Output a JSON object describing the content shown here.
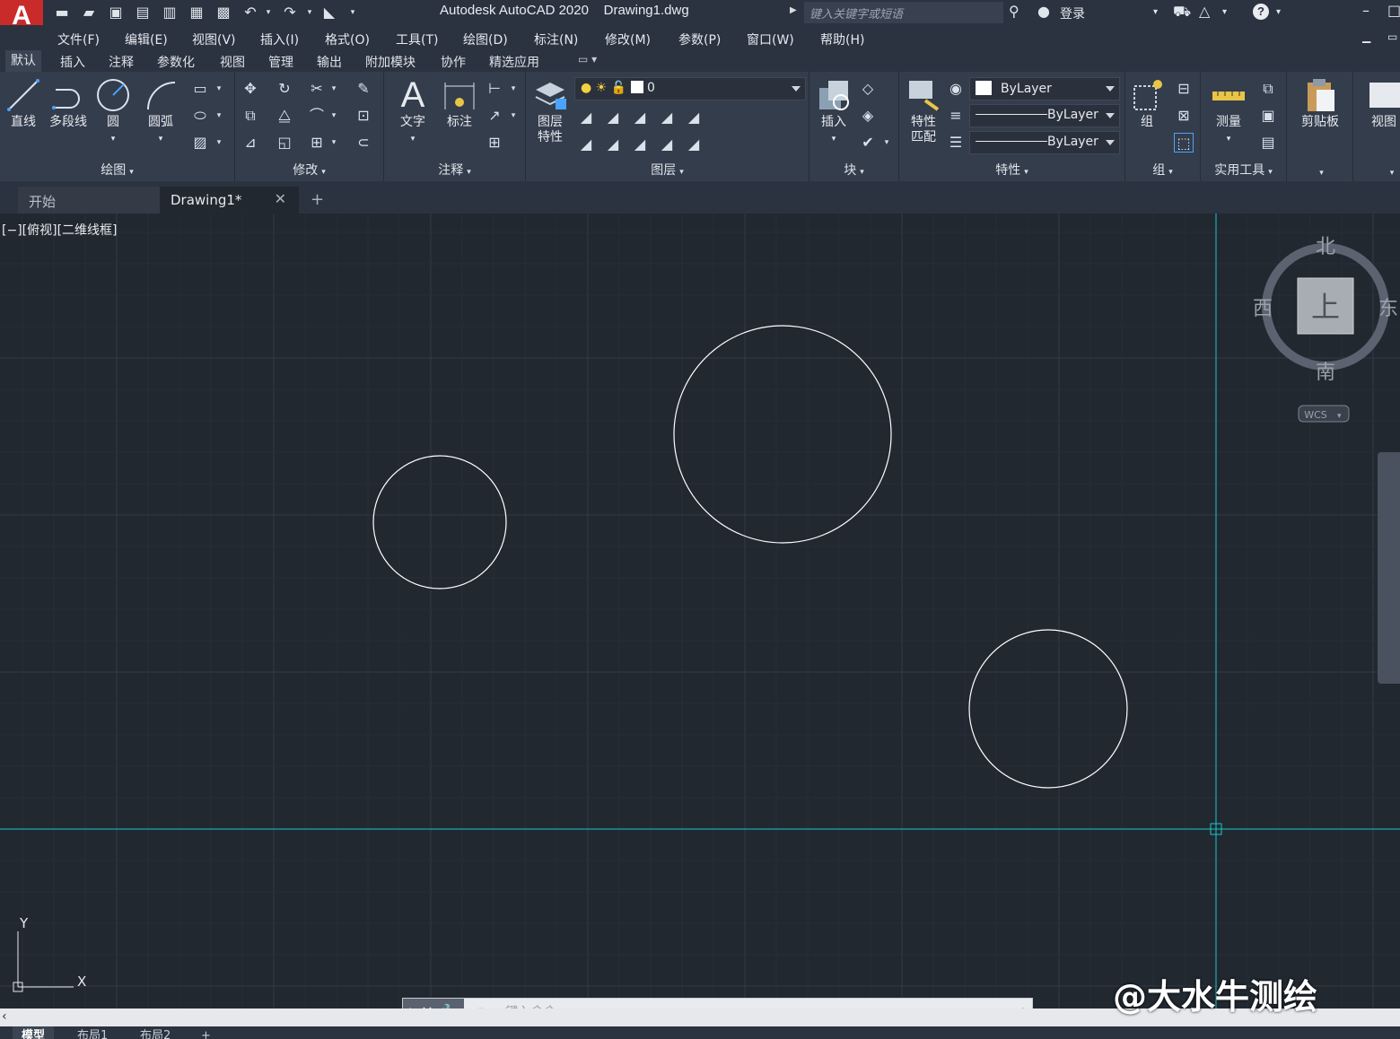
{
  "title_bar": {
    "app_letter": "A",
    "title": "Autodesk AutoCAD 2020    Drawing1.dwg",
    "search_placeholder": "键入关键字或短语",
    "login": "登录"
  },
  "menu": [
    "文件(F)",
    "编辑(E)",
    "视图(V)",
    "插入(I)",
    "格式(O)",
    "工具(T)",
    "绘图(D)",
    "标注(N)",
    "修改(M)",
    "参数(P)",
    "窗口(W)",
    "帮助(H)"
  ],
  "ribbon_tabs": [
    "默认",
    "插入",
    "注释",
    "参数化",
    "视图",
    "管理",
    "输出",
    "附加模块",
    "协作",
    "精选应用"
  ],
  "ribbon": {
    "draw": {
      "title": "绘图",
      "line": "直线",
      "polyline": "多段线",
      "circle": "圆",
      "arc": "圆弧"
    },
    "modify": {
      "title": "修改"
    },
    "annotation": {
      "title": "注释",
      "text": "文字",
      "dimension": "标注"
    },
    "layers": {
      "title": "图层",
      "props_line1": "图层",
      "props_line2": "特性",
      "current_layer": "0"
    },
    "block": {
      "title": "块",
      "insert": "插入"
    },
    "properties": {
      "title": "特性",
      "match_line1": "特性",
      "match_line2": "匹配",
      "color": "ByLayer",
      "linetype": "ByLayer",
      "lineweight": "ByLayer"
    },
    "groups": {
      "title": "组",
      "group": "组"
    },
    "utilities": {
      "title": "实用工具",
      "measure": "测量"
    },
    "clipboard": {
      "title": "剪贴板"
    },
    "view": {
      "title": "视图"
    }
  },
  "file_tabs": {
    "start": "开始",
    "drawing": "Drawing1*"
  },
  "viewport": {
    "view_label": "[−][俯视][二维线框]",
    "viewcube": {
      "north": "北",
      "south": "南",
      "east": "东",
      "west": "西",
      "top": "上",
      "wcs": "WCS"
    },
    "ucs": {
      "x": "X",
      "y": "Y"
    },
    "watermark": "@大水牛测绘"
  },
  "command_line": {
    "placeholder": "键入命令"
  },
  "status_tabs": [
    "模型",
    "布局1",
    "布局2"
  ],
  "colors": {
    "background": "#212830",
    "crosshair": "#19c8c8",
    "circle": "#ffffff",
    "logo": "#c92b2b"
  },
  "icons": [
    "new-icon",
    "open-icon",
    "save-icon",
    "saveas-icon",
    "plot-icon",
    "undo-icon",
    "redo-icon",
    "search-icon",
    "user-icon",
    "cart-icon",
    "help-icon",
    "close-icon",
    "wrench-icon"
  ]
}
